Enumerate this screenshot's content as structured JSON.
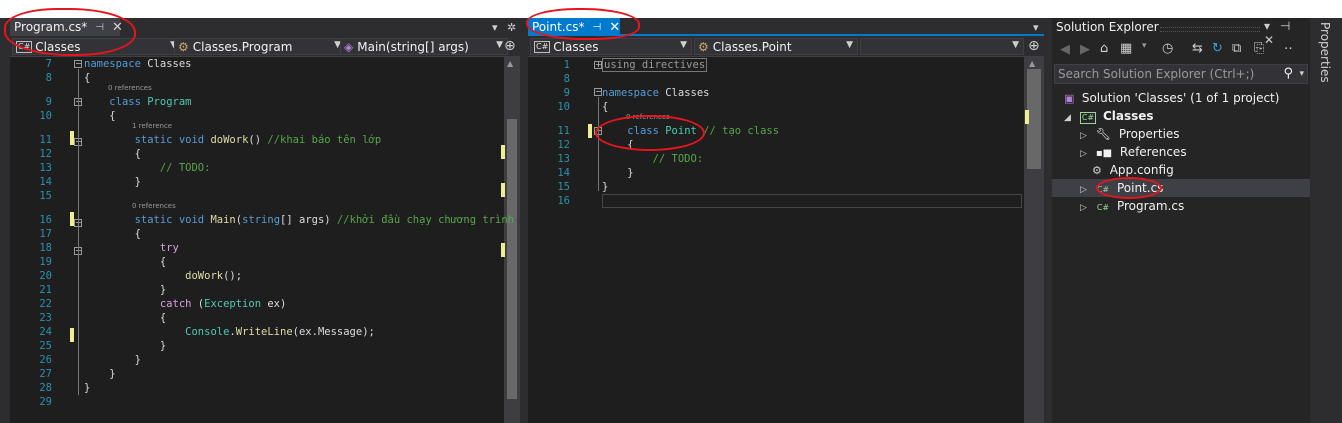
{
  "left_editor": {
    "tab_label": "Program.cs*",
    "pin": "⊣",
    "close": "✕",
    "nav_project": "Classes",
    "nav_class": "Classes.Program",
    "nav_member": "Main(string[] args)",
    "lines": [
      {
        "num": "7",
        "parts": [
          [
            "kw",
            "namespace"
          ],
          [
            "tx",
            " Classes"
          ]
        ]
      },
      {
        "num": "8",
        "parts": [
          [
            "tx",
            "{"
          ]
        ]
      },
      {
        "num": "9",
        "lens": "0 references",
        "parts": [
          [
            "tx",
            "    "
          ],
          [
            "kw",
            "class"
          ],
          [
            "tx",
            " "
          ],
          [
            "ty",
            "Program"
          ]
        ]
      },
      {
        "num": "10",
        "parts": [
          [
            "tx",
            "    {"
          ]
        ]
      },
      {
        "num": "11",
        "lens": "1 reference",
        "parts": [
          [
            "tx",
            "        "
          ],
          [
            "kw",
            "static"
          ],
          [
            "tx",
            " "
          ],
          [
            "kw",
            "void"
          ],
          [
            "tx",
            " "
          ],
          [
            "fn",
            "doWork"
          ],
          [
            "tx",
            "() "
          ],
          [
            "cm",
            "//khai báo tên lớp"
          ]
        ]
      },
      {
        "num": "12",
        "parts": [
          [
            "tx",
            "        {"
          ]
        ]
      },
      {
        "num": "13",
        "parts": [
          [
            "tx",
            "            "
          ],
          [
            "cm",
            "// TODO:"
          ]
        ]
      },
      {
        "num": "14",
        "parts": [
          [
            "tx",
            "        }"
          ]
        ]
      },
      {
        "num": "15",
        "parts": [
          [
            "tx",
            ""
          ]
        ]
      },
      {
        "num": "16",
        "lens": "0 references",
        "parts": [
          [
            "tx",
            "        "
          ],
          [
            "kw",
            "static"
          ],
          [
            "tx",
            " "
          ],
          [
            "kw",
            "void"
          ],
          [
            "tx",
            " "
          ],
          [
            "fn",
            "Main"
          ],
          [
            "tx",
            "("
          ],
          [
            "kw",
            "string"
          ],
          [
            "tx",
            "[] "
          ],
          [
            "tx",
            "args"
          ],
          [
            "tx",
            ") "
          ],
          [
            "cm",
            "//khởi đầu chạy chương trình"
          ]
        ]
      },
      {
        "num": "17",
        "parts": [
          [
            "tx",
            "        {"
          ]
        ]
      },
      {
        "num": "18",
        "parts": [
          [
            "tx",
            "            "
          ],
          [
            "kwc",
            "try"
          ]
        ]
      },
      {
        "num": "19",
        "parts": [
          [
            "tx",
            "            {"
          ]
        ]
      },
      {
        "num": "20",
        "parts": [
          [
            "tx",
            "                "
          ],
          [
            "fn",
            "doWork"
          ],
          [
            "tx",
            "();"
          ]
        ]
      },
      {
        "num": "21",
        "parts": [
          [
            "tx",
            "            }"
          ]
        ]
      },
      {
        "num": "22",
        "parts": [
          [
            "tx",
            "            "
          ],
          [
            "kwc",
            "catch"
          ],
          [
            "tx",
            " ("
          ],
          [
            "ty",
            "Exception"
          ],
          [
            "tx",
            " ex)"
          ]
        ]
      },
      {
        "num": "23",
        "parts": [
          [
            "tx",
            "            {"
          ]
        ]
      },
      {
        "num": "24",
        "parts": [
          [
            "tx",
            "                "
          ],
          [
            "ty",
            "Console"
          ],
          [
            "tx",
            "."
          ],
          [
            "fn",
            "WriteLine"
          ],
          [
            "tx",
            "(ex.Message);"
          ]
        ]
      },
      {
        "num": "25",
        "parts": [
          [
            "tx",
            "            }"
          ]
        ]
      },
      {
        "num": "26",
        "parts": [
          [
            "tx",
            "        }"
          ]
        ]
      },
      {
        "num": "27",
        "parts": [
          [
            "tx",
            "    }"
          ]
        ]
      },
      {
        "num": "28",
        "parts": [
          [
            "tx",
            "}"
          ]
        ]
      },
      {
        "num": "29",
        "parts": [
          [
            "tx",
            ""
          ]
        ]
      }
    ]
  },
  "right_editor": {
    "tab_label": "Point.cs*",
    "pin": "⊣",
    "close": "✕",
    "nav_project": "Classes",
    "nav_class": "Classes.Point",
    "lines": [
      {
        "num": "1",
        "parts": [
          [
            "tx",
            ""
          ]
        ],
        "collapsed": "using directives"
      },
      {
        "num": "8",
        "parts": [
          [
            "tx",
            ""
          ]
        ]
      },
      {
        "num": "9",
        "parts": [
          [
            "kw",
            "namespace"
          ],
          [
            "tx",
            " Classes"
          ]
        ]
      },
      {
        "num": "10",
        "parts": [
          [
            "tx",
            "{"
          ]
        ]
      },
      {
        "num": "11",
        "lens": "0 references",
        "parts": [
          [
            "tx",
            "    "
          ],
          [
            "kw",
            "class"
          ],
          [
            "tx",
            " "
          ],
          [
            "ty",
            "Point"
          ],
          [
            "tx",
            " "
          ],
          [
            "cm",
            "// tạo class"
          ]
        ]
      },
      {
        "num": "12",
        "parts": [
          [
            "tx",
            "    {"
          ]
        ]
      },
      {
        "num": "13",
        "parts": [
          [
            "tx",
            "        "
          ],
          [
            "cm",
            "// TODO:"
          ]
        ]
      },
      {
        "num": "14",
        "parts": [
          [
            "tx",
            "    }"
          ]
        ]
      },
      {
        "num": "15",
        "parts": [
          [
            "tx",
            "}"
          ]
        ]
      },
      {
        "num": "16",
        "parts": [
          [
            "tx",
            ""
          ]
        ]
      }
    ]
  },
  "solution_explorer": {
    "title": "Solution Explorer",
    "title_controls": "▾ ⊣ ✕",
    "search_placeholder": "Search Solution Explorer (Ctrl+;)",
    "solution": "Solution 'Classes' (1 of 1 project)",
    "project": "Classes",
    "items": [
      "Properties",
      "References",
      "App.config",
      "Point.cs",
      "Program.cs"
    ]
  },
  "side_panel": {
    "label": "Properties"
  },
  "colors": {
    "accent": "#007acc",
    "annotation": "#e8141e"
  }
}
